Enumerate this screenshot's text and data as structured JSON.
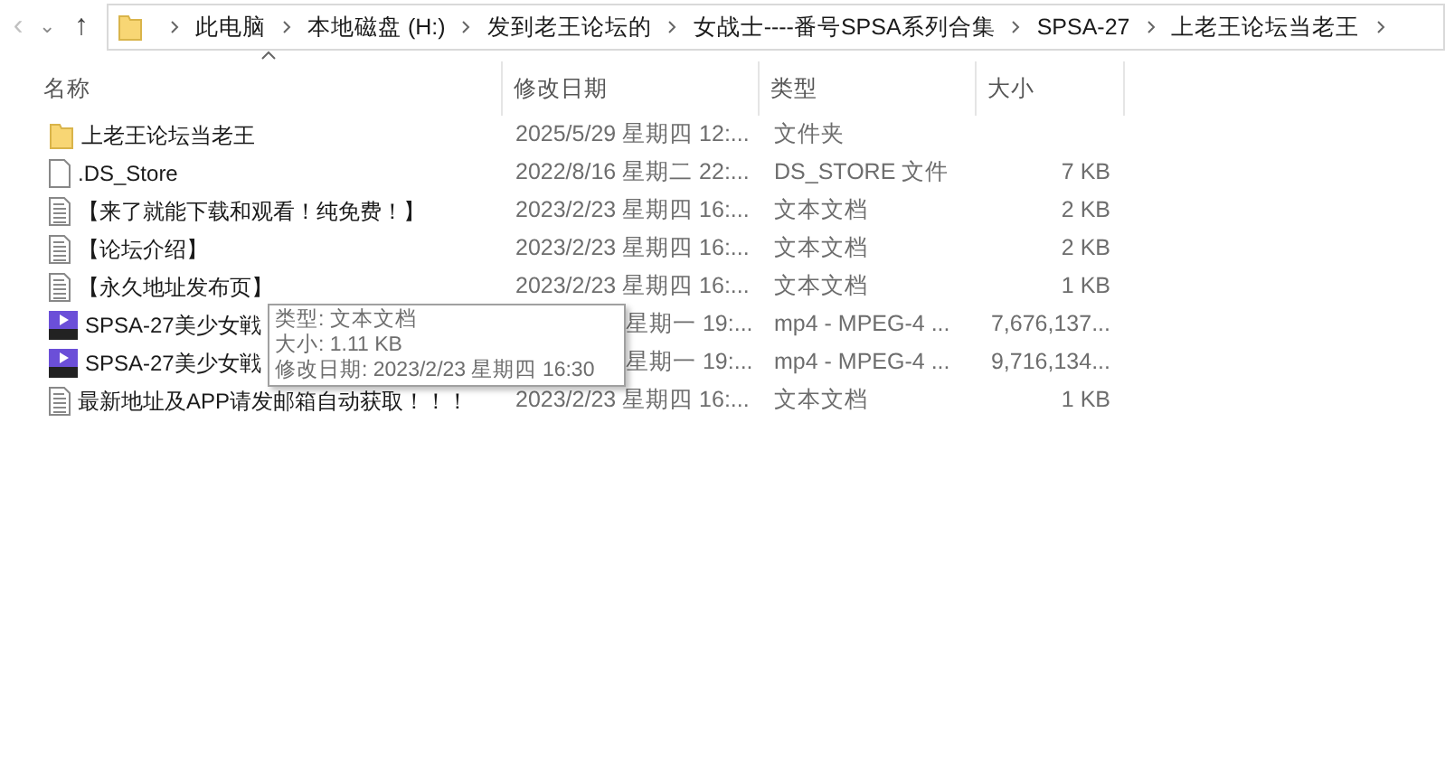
{
  "nav": {
    "back": "‹",
    "recent": "⌄",
    "up": "↑"
  },
  "breadcrumbs": [
    "此电脑",
    "本地磁盘 (H:)",
    "发到老王论坛的",
    "女战士----番号SPSA系列合集",
    "SPSA-27",
    "上老王论坛当老王"
  ],
  "columns": [
    {
      "label": "名称",
      "sorted": true
    },
    {
      "label": "修改日期",
      "sorted": false
    },
    {
      "label": "类型",
      "sorted": false
    },
    {
      "label": "大小",
      "sorted": false
    }
  ],
  "rows": [
    {
      "kind": "folder",
      "name": "上老王论坛当老王",
      "date": "2025/5/29 星期四 12:...",
      "type": "文件夹",
      "size": ""
    },
    {
      "kind": "blank",
      "name": ".DS_Store",
      "date": "2022/8/16 星期二 22:...",
      "type": "DS_STORE 文件",
      "size": "7 KB"
    },
    {
      "kind": "text",
      "name": "【来了就能下载和观看！纯免费！】",
      "date": "2023/2/23 星期四 16:...",
      "type": "文本文档",
      "size": "2 KB"
    },
    {
      "kind": "text",
      "name": "【论坛介绍】",
      "date": "2023/2/23 星期四 16:...",
      "type": "文本文档",
      "size": "2 KB"
    },
    {
      "kind": "text",
      "name": "【永久地址发布页】",
      "date": "2023/2/23 星期四 16:...",
      "type": "文本文档",
      "size": "1 KB"
    },
    {
      "kind": "video",
      "name": "SPSA-27美少女戦",
      "date": "星期一 19:...",
      "type": "mp4 - MPEG-4 ...",
      "size": "7,676,137..."
    },
    {
      "kind": "video",
      "name": "SPSA-27美少女戦",
      "date": "星期一 19:...",
      "type": "mp4 - MPEG-4 ...",
      "size": "9,716,134..."
    },
    {
      "kind": "text",
      "name": "最新地址及APP请发邮箱自动获取！！！",
      "date": "2023/2/23 星期四 16:...",
      "type": "文本文档",
      "size": "1 KB"
    }
  ],
  "tooltip": {
    "lines": [
      "类型: 文本文档",
      "大小: 1.11 KB",
      "修改日期: 2023/2/23 星期四 16:30"
    ]
  }
}
